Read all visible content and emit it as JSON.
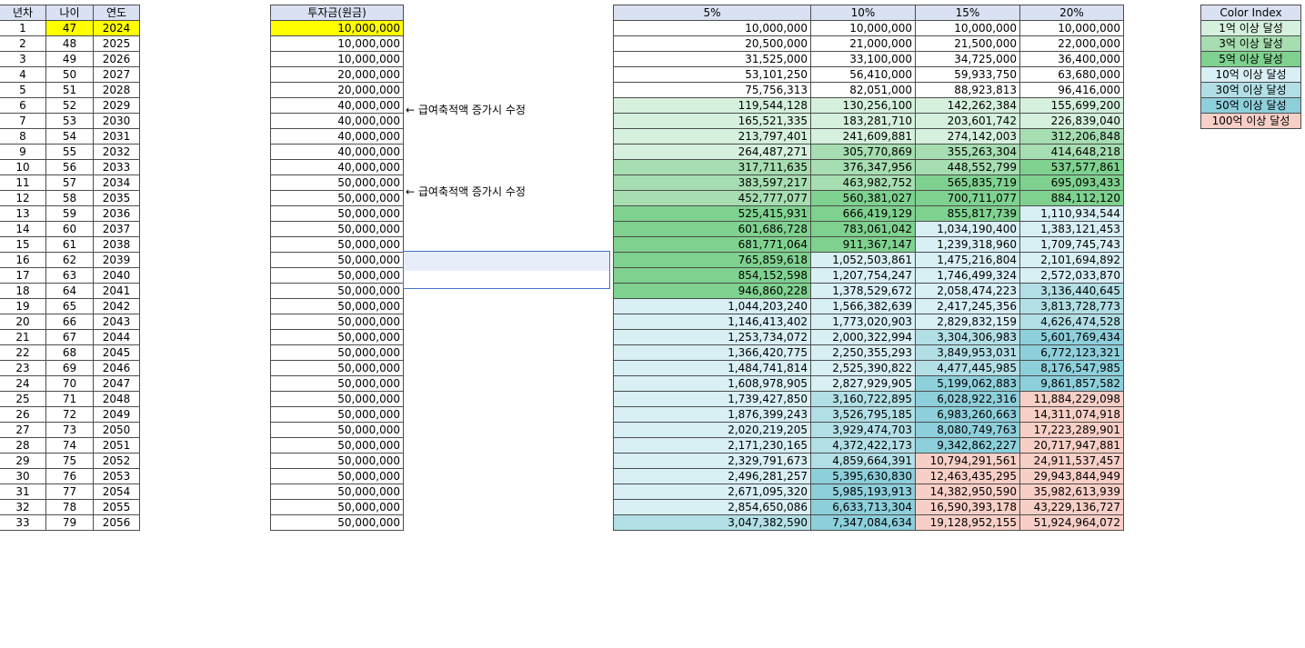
{
  "left_table": {
    "headers": [
      "년차",
      "나이",
      "연도"
    ],
    "highlight_row": 0,
    "highlight_color": "#ffff00"
  },
  "invest_table": {
    "header": "투자금(원금)",
    "values": [
      "10,000,000",
      "10,000,000",
      "10,000,000",
      "20,000,000",
      "20,000,000",
      "40,000,000",
      "40,000,000",
      "40,000,000",
      "40,000,000",
      "40,000,000",
      "50,000,000",
      "50,000,000",
      "50,000,000",
      "50,000,000",
      "50,000,000",
      "50,000,000",
      "50,000,000",
      "50,000,000",
      "50,000,000",
      "50,000,000",
      "50,000,000",
      "50,000,000",
      "50,000,000",
      "50,000,000",
      "50,000,000",
      "50,000,000",
      "50,000,000",
      "50,000,000",
      "50,000,000",
      "50,000,000",
      "50,000,000",
      "50,000,000",
      "50,000,000"
    ]
  },
  "notes": [
    {
      "row": 5,
      "text": "← 급여축적액 증가시 수정"
    },
    {
      "row": 10,
      "text": "← 급여축적액 증가시 수정"
    }
  ],
  "growth_table": {
    "headers": [
      "5%",
      "10%",
      "15%",
      "20%"
    ],
    "columns": [
      [
        "10,000,000",
        "20,500,000",
        "31,525,000",
        "53,101,250",
        "75,756,313",
        "119,544,128",
        "165,521,335",
        "213,797,401",
        "264,487,271",
        "317,711,635",
        "383,597,217",
        "452,777,077",
        "525,415,931",
        "601,686,728",
        "681,771,064",
        "765,859,618",
        "854,152,598",
        "946,860,228",
        "1,044,203,240",
        "1,146,413,402",
        "1,253,734,072",
        "1,366,420,775",
        "1,484,741,814",
        "1,608,978,905",
        "1,739,427,850",
        "1,876,399,243",
        "2,020,219,205",
        "2,171,230,165",
        "2,329,791,673",
        "2,496,281,257",
        "2,671,095,320",
        "2,854,650,086",
        "3,047,382,590"
      ],
      [
        "10,000,000",
        "21,000,000",
        "33,100,000",
        "56,410,000",
        "82,051,000",
        "130,256,100",
        "183,281,710",
        "241,609,881",
        "305,770,869",
        "376,347,956",
        "463,982,752",
        "560,381,027",
        "666,419,129",
        "783,061,042",
        "911,367,147",
        "1,052,503,861",
        "1,207,754,247",
        "1,378,529,672",
        "1,566,382,639",
        "1,773,020,903",
        "2,000,322,994",
        "2,250,355,293",
        "2,525,390,822",
        "2,827,929,905",
        "3,160,722,895",
        "3,526,795,185",
        "3,929,474,703",
        "4,372,422,173",
        "4,859,664,391",
        "5,395,630,830",
        "5,985,193,913",
        "6,633,713,304",
        "7,347,084,634"
      ],
      [
        "10,000,000",
        "21,500,000",
        "34,725,000",
        "59,933,750",
        "88,923,813",
        "142,262,384",
        "203,601,742",
        "274,142,003",
        "355,263,304",
        "448,552,799",
        "565,835,719",
        "700,711,077",
        "855,817,739",
        "1,034,190,400",
        "1,239,318,960",
        "1,475,216,804",
        "1,746,499,324",
        "2,058,474,223",
        "2,417,245,356",
        "2,829,832,159",
        "3,304,306,983",
        "3,849,953,031",
        "4,477,445,985",
        "5,199,062,883",
        "6,028,922,316",
        "6,983,260,663",
        "8,080,749,763",
        "9,342,862,227",
        "10,794,291,561",
        "12,463,435,295",
        "14,382,950,590",
        "16,590,393,178",
        "19,128,952,155"
      ],
      [
        "10,000,000",
        "22,000,000",
        "36,400,000",
        "63,680,000",
        "96,416,000",
        "155,699,200",
        "226,839,040",
        "312,206,848",
        "414,648,218",
        "537,577,861",
        "695,093,433",
        "884,112,120",
        "1,110,934,544",
        "1,383,121,453",
        "1,709,745,743",
        "2,101,694,892",
        "2,572,033,870",
        "3,136,440,645",
        "3,813,728,773",
        "4,626,474,528",
        "5,601,769,434",
        "6,772,123,321",
        "8,176,547,985",
        "9,861,857,582",
        "11,884,229,098",
        "14,311,074,918",
        "17,223,289,901",
        "20,717,947,881",
        "24,911,537,457",
        "29,943,844,949",
        "35,982,613,939",
        "43,229,136,727",
        "51,924,964,072"
      ]
    ]
  },
  "legend": {
    "header": "Color Index",
    "items": [
      {
        "label": "1억 이상 달성",
        "color": "#d5f0dc"
      },
      {
        "label": "3억 이상 달성",
        "color": "#a6ddb1"
      },
      {
        "label": "5억 이상 달성",
        "color": "#7fd18f"
      },
      {
        "label": "10억 이상 달성",
        "color": "#d8eff4"
      },
      {
        "label": "30억 이상 달성",
        "color": "#b2dfe6"
      },
      {
        "label": "50억 이상 달성",
        "color": "#8dcfdb"
      },
      {
        "label": "100억 이상 달성",
        "color": "#f8cfc7"
      }
    ]
  }
}
